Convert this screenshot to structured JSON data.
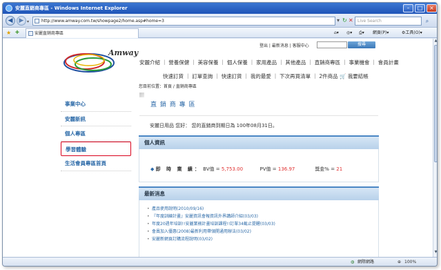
{
  "window": {
    "title": "安麗直銷商專區 - Windows Internet Explorer",
    "url": "http://www.amway.com.tw/showpage2/home.asp#home=3",
    "search_placeholder": "Live Search",
    "tab_label": "安麗直銷商專區",
    "toolbar": {
      "page_label": "網頁(P)",
      "tools_label": "工具(O)"
    },
    "status": {
      "zone": "網際網路",
      "zoom": "100%"
    }
  },
  "header": {
    "logo_text": "Amway",
    "top_links": [
      "登出",
      "最新消息",
      "客服中心"
    ],
    "search_button": "搜尋",
    "main_nav": [
      "安麗介紹",
      "營養保健",
      "美容保養",
      "個人保養",
      "家用產品",
      "其他產品",
      "直銷商專區",
      "事業機會",
      "會員計畫"
    ],
    "sub_nav": [
      "快速訂貨",
      "訂單查詢",
      "快速訂貨",
      "我的最愛",
      "下次再買清單",
      "2件商品",
      "我要結帳"
    ]
  },
  "breadcrumb": "您目前位置：首頁 / 直銷商專區",
  "page_title": "直 銷 商 專 區",
  "notice": "安麗日用品 您好： 您的直銷商到期日為 100年08月31日。",
  "left_menu": [
    {
      "label": "事業中心"
    },
    {
      "label": "安麗新訊"
    },
    {
      "label": "個人專區"
    },
    {
      "label": "學習體驗",
      "selected": true
    },
    {
      "label": "生活會員專區首頁"
    }
  ],
  "personal": {
    "heading": "個人資訊",
    "perf_label": "即 時 業 績：",
    "bv_label": "BV值 =",
    "bv_value": "5,753.00",
    "pv_label": "PV值 =",
    "pv_value": "136.97",
    "bonus_label": "獎金% =",
    "bonus_value": "21"
  },
  "news": {
    "heading": "最新消息",
    "items": [
      "產品使用說明(2010/09/16)",
      "『年度訓練計畫』安麗資訊會報資訊外界講師介紹(03/03)",
      "年度20週年培訓!!安麗業務計畫培訓課程!!訂單34截止提醒(03/03)",
      "會員加入優惠(2008)最新利用帶領開通用辦法(03/02)",
      "安麗新網頁訂購流程說明(03/02)"
    ]
  }
}
